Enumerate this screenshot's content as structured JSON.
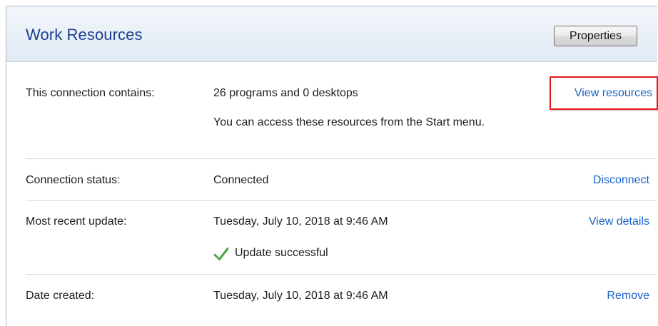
{
  "header": {
    "title": "Work Resources",
    "properties_label": "Properties"
  },
  "rows": {
    "contains": {
      "label": "This connection contains:",
      "value": "26 programs and 0 desktops",
      "note": "You can access these resources from the Start menu.",
      "link": "View resources"
    },
    "status": {
      "label": "Connection status:",
      "value": "Connected",
      "link": "Disconnect"
    },
    "update": {
      "label": "Most recent update:",
      "value": "Tuesday, July 10, 2018 at 9:46 AM",
      "result": "Update successful",
      "result_icon": "checkmark-icon",
      "link": "View details"
    },
    "created": {
      "label": "Date created:",
      "value": "Tuesday, July 10, 2018 at 9:46 AM",
      "link": "Remove"
    }
  },
  "colors": {
    "title": "#1c3f8f",
    "link": "#1a64c8",
    "highlight": "#e3171d",
    "check": "#4cb648"
  }
}
